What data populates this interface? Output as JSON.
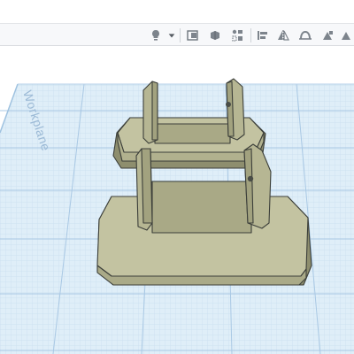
{
  "toolbar": {
    "tools": [
      {
        "name": "light-bulb-icon"
      },
      {
        "name": "dropdown-caret-icon"
      },
      {
        "name": "view-cube-icon"
      },
      {
        "name": "solid-shapes-icon"
      },
      {
        "name": "note-icon"
      },
      {
        "name": "workplane-icon"
      },
      {
        "name": "align-icon"
      },
      {
        "name": "mirror-icon"
      },
      {
        "name": "group-icon"
      },
      {
        "name": "ungroup-icon"
      }
    ]
  },
  "workplane": {
    "label": "Workplane"
  },
  "colors": {
    "grid_background": "#dfeef8",
    "grid_minor": "#c9def0",
    "grid_major": "#9fc2e0",
    "model_face": "#b6b693",
    "model_top": "#c3c3a1",
    "model_edge": "#3c3f3a",
    "model_shadow": "#8e8e6e"
  }
}
